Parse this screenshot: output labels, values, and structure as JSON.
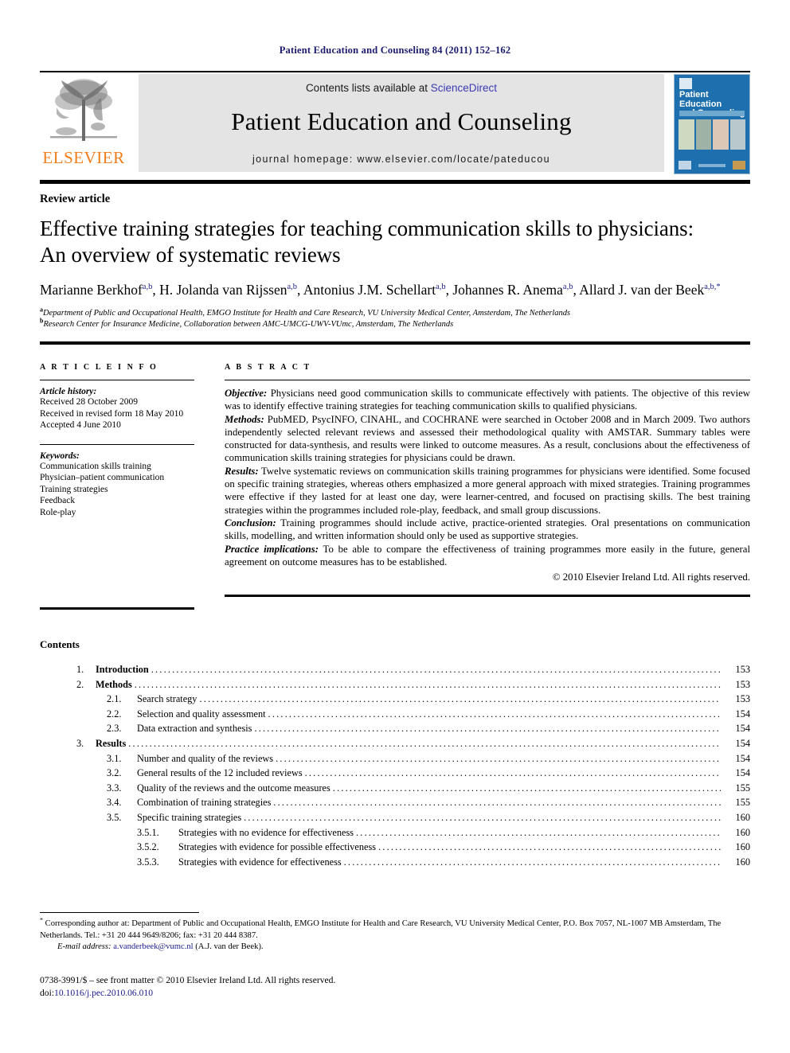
{
  "running_head": "Patient Education and Counseling 84 (2011) 152–162",
  "masthead": {
    "publisher_logo_name": "ELSEVIER",
    "contents_prefix": "Contents lists available at ",
    "sciencedirect": "ScienceDirect",
    "journal_title": "Patient Education and Counseling",
    "homepage": "journal homepage: www.elsevier.com/locate/pateducou",
    "cover": {
      "title_line1": "Patient Education",
      "title_line2": "and Counseling"
    },
    "link_color": "#3a3ab4",
    "logo_color": "#ef7d1a"
  },
  "article": {
    "type": "Review article",
    "title_line1": "Effective training strategies for teaching communication skills to physicians:",
    "title_line2": "An overview of systematic reviews",
    "authors_line1_parts": [
      {
        "name": "Marianne Berkhof",
        "sup": "a,b"
      },
      {
        "name": "H. Jolanda van Rijssen",
        "sup": "a,b"
      },
      {
        "name": "Antonius J.M. Schellart",
        "sup": "a,b"
      },
      {
        "name": "Johannes R. Anema",
        "sup": "a,b"
      }
    ],
    "authors_line2_parts": [
      {
        "name": "Allard J. van der Beek",
        "sup": "a,b,*"
      }
    ],
    "affiliation_a_marker": "a",
    "affiliation_a": "Department of Public and Occupational Health, EMGO Institute for Health and Care Research, VU University Medical Center, Amsterdam, The Netherlands",
    "affiliation_b_marker": "b",
    "affiliation_b": "Research Center for Insurance Medicine, Collaboration between AMC-UMCG-UWV-VUmc, Amsterdam, The Netherlands"
  },
  "info": {
    "heading": "A R T I C L E  I N F O",
    "history_label": "Article history:",
    "history": [
      "Received 28 October 2009",
      "Received in revised form 18 May 2010",
      "Accepted 4 June 2010"
    ],
    "keywords_label": "Keywords:",
    "keywords": [
      "Communication skills training",
      "Physician–patient communication",
      "Training strategies",
      "Feedback",
      "Role-play"
    ]
  },
  "abstract": {
    "heading": "A B S T R A C T",
    "sections": [
      {
        "label": "Objective:",
        "text": " Physicians need good communication skills to communicate effectively with patients. The objective of this review was to identify effective training strategies for teaching communication skills to qualified physicians."
      },
      {
        "label": "Methods:",
        "text": " PubMED, PsycINFO, CINAHL, and COCHRANE were searched in October 2008 and in March 2009. Two authors independently selected relevant reviews and assessed their methodological quality with AMSTAR. Summary tables were constructed for data-synthesis, and results were linked to outcome measures. As a result, conclusions about the effectiveness of communication skills training strategies for physicians could be drawn."
      },
      {
        "label": "Results:",
        "text": " Twelve systematic reviews on communication skills training programmes for physicians were identified. Some focused on specific training strategies, whereas others emphasized a more general approach with mixed strategies. Training programmes were effective if they lasted for at least one day, were learner-centred, and focused on practising skills. The best training strategies within the programmes included role-play, feedback, and small group discussions."
      },
      {
        "label": "Conclusion:",
        "text": " Training programmes should include active, practice-oriented strategies. Oral presentations on communication skills, modelling, and written information should only be used as supportive strategies."
      },
      {
        "label": "Practice implications:",
        "text": " To be able to compare the effectiveness of training programmes more easily in the future, general agreement on outcome measures has to be established."
      }
    ],
    "copyright": "© 2010 Elsevier Ireland Ltd. All rights reserved."
  },
  "contents": {
    "heading": "Contents",
    "entries": [
      {
        "level": 1,
        "num": "1.",
        "label": "Introduction",
        "page": "153"
      },
      {
        "level": 1,
        "num": "2.",
        "label": "Methods",
        "page": "153"
      },
      {
        "level": 2,
        "num": "2.1.",
        "label": "Search strategy",
        "page": "153"
      },
      {
        "level": 2,
        "num": "2.2.",
        "label": "Selection and quality assessment",
        "page": "154"
      },
      {
        "level": 2,
        "num": "2.3.",
        "label": "Data extraction and synthesis",
        "page": "154"
      },
      {
        "level": 1,
        "num": "3.",
        "label": "Results",
        "page": "154"
      },
      {
        "level": 2,
        "num": "3.1.",
        "label": "Number and quality of the reviews",
        "page": "154"
      },
      {
        "level": 2,
        "num": "3.2.",
        "label": "General results of the 12 included reviews",
        "page": "154"
      },
      {
        "level": 2,
        "num": "3.3.",
        "label": "Quality of the reviews and the outcome measures",
        "page": "155"
      },
      {
        "level": 2,
        "num": "3.4.",
        "label": "Combination of training strategies",
        "page": "155"
      },
      {
        "level": 2,
        "num": "3.5.",
        "label": "Specific training strategies",
        "page": "160"
      },
      {
        "level": 3,
        "num": "3.5.1.",
        "label": "Strategies with no evidence for effectiveness",
        "page": "160"
      },
      {
        "level": 3,
        "num": "3.5.2.",
        "label": "Strategies with evidence for possible effectiveness",
        "page": "160"
      },
      {
        "level": 3,
        "num": "3.5.3.",
        "label": "Strategies with evidence for effectiveness",
        "page": "160"
      }
    ]
  },
  "footnotes": {
    "corresponding_marker": "*",
    "corresponding": " Corresponding author at: Department of Public and Occupational Health, EMGO Institute for Health and Care Research, VU University Medical Center, P.O. Box 7057, NL-1007 MB Amsterdam, The Netherlands. Tel.: +31 20 444 9649/8206; fax: +31 20 444 8387.",
    "email_label": "E-mail address:",
    "email": "a.vanderbeek@vumc.nl",
    "email_suffix": " (A.J. van der Beek).",
    "front_matter": "0738-3991/$ – see front matter © 2010 Elsevier Ireland Ltd. All rights reserved.",
    "doi_label": "doi:",
    "doi": "10.1016/j.pec.2010.06.010"
  }
}
